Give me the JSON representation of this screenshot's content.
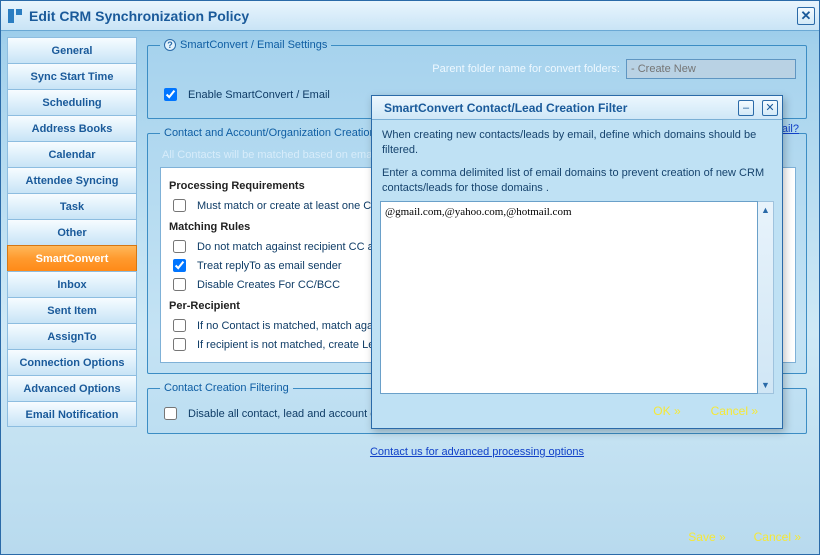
{
  "window": {
    "title": "Edit CRM Synchronization Policy"
  },
  "sidebar": {
    "items": [
      {
        "label": "General"
      },
      {
        "label": "Sync Start Time"
      },
      {
        "label": "Scheduling"
      },
      {
        "label": "Address Books"
      },
      {
        "label": "Calendar"
      },
      {
        "label": "Attendee Syncing"
      },
      {
        "label": "Task"
      },
      {
        "label": "Other"
      },
      {
        "label": "SmartConvert",
        "active": true
      },
      {
        "label": "Inbox"
      },
      {
        "label": "Sent Item"
      },
      {
        "label": "AssignTo"
      },
      {
        "label": "Connection Options"
      },
      {
        "label": "Advanced Options"
      },
      {
        "label": "Email Notification"
      }
    ]
  },
  "smartconvert": {
    "group_title": "SmartConvert / Email Settings",
    "enable_label": "Enable SmartConvert / Email",
    "enable_checked": true,
    "parent_label": "Parent folder name for convert folders:",
    "parent_placeholder": "- Create New",
    "email_link": "Email?"
  },
  "creation": {
    "group_title": "Contact and Account/Organization Creation",
    "hint": "All Contacts will be matched based on email address.",
    "headers": {
      "processing": "Processing Requirements",
      "matching": "Matching Rules",
      "per_recipient": "Per-Recipient"
    },
    "rules": {
      "must_match": {
        "label": "Must match or create at least one Contact",
        "checked": false
      },
      "no_cc": {
        "label": "Do not match against recipient CC and BCC",
        "checked": false
      },
      "replyto": {
        "label": "Treat replyTo as email sender",
        "checked": true
      },
      "disable_cc": {
        "label": "Disable Creates For CC/BCC",
        "checked": false
      },
      "if_no_contact": {
        "label": "If no Contact is matched, match against Lead",
        "checked": false
      },
      "if_recipient": {
        "label": "If recipient is not matched, create Lead",
        "checked": false
      }
    }
  },
  "filtering": {
    "group_title": "Contact Creation Filtering",
    "disable_all": {
      "label": "Disable all contact, lead and account creation",
      "checked": false
    }
  },
  "contact_link": "Contact us for advanced processing options",
  "footer": {
    "save": "Save »",
    "cancel": "Cancel »"
  },
  "modal": {
    "title": "SmartConvert Contact/Lead Creation Filter",
    "desc1": "When creating new contacts/leads by email, define which domains should be filtered.",
    "desc2": "Enter a comma delimited list of email domains to prevent creation of new CRM contacts/leads for those domains .",
    "textarea_value": "@gmail.com,@yahoo.com,@hotmail.com",
    "ok": "OK »",
    "cancel": "Cancel »"
  }
}
